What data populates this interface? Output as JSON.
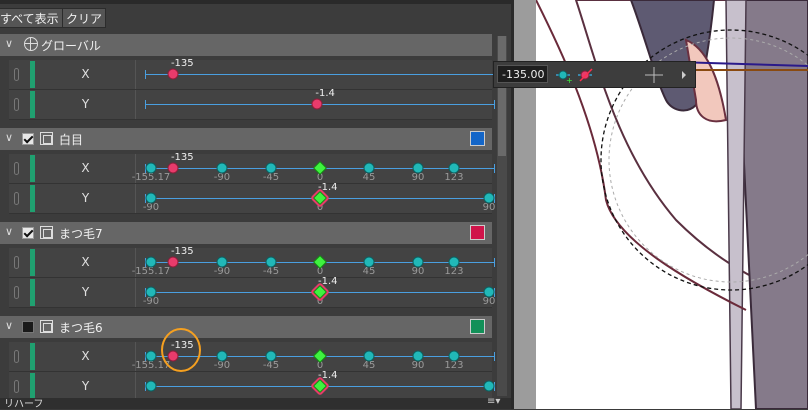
{
  "toolbar": {
    "show_all_label": "すべて表示",
    "clear_label": "クリア"
  },
  "groups": [
    {
      "name": "グローバル",
      "type": "global",
      "checked": null,
      "color": null,
      "rows": [
        {
          "axis": "X",
          "value_label": "-135",
          "labels": [],
          "keys": [
            {
              "v": -135,
              "state": "red",
              "label_pos": -135
            }
          ],
          "range": [
            -155.17,
            155.17
          ]
        },
        {
          "axis": "Y",
          "value_label": "-1.4",
          "labels": [],
          "keys": [
            {
              "v": -1.4,
              "state": "red"
            }
          ],
          "range": [
            -90,
            90
          ]
        }
      ]
    },
    {
      "name": "白目",
      "type": "layer",
      "checked": true,
      "color": "#1466c8",
      "rows": [
        {
          "axis": "X",
          "value_label": "-135",
          "labels": [
            "-155.17",
            "-90",
            "-45",
            "0",
            "45",
            "90",
            "123"
          ],
          "keys": [
            {
              "v": -155.17,
              "state": "teal"
            },
            {
              "v": -135,
              "state": "red"
            },
            {
              "v": -90,
              "state": "teal"
            },
            {
              "v": -45,
              "state": "teal"
            },
            {
              "v": 0,
              "state": "green"
            },
            {
              "v": 45,
              "state": "teal"
            },
            {
              "v": 90,
              "state": "teal"
            },
            {
              "v": 123,
              "state": "teal"
            }
          ],
          "range": [
            -155.17,
            155.17
          ]
        },
        {
          "axis": "Y",
          "value_label": "-1.4",
          "labels": [
            "-90",
            "0",
            "90"
          ],
          "keys": [
            {
              "v": -90,
              "state": "teal"
            },
            {
              "v": 0,
              "state": "green_ring"
            },
            {
              "v": 90,
              "state": "teal"
            }
          ],
          "range": [
            -90,
            90
          ]
        }
      ]
    },
    {
      "name": "まつ毛7",
      "type": "layer",
      "checked": true,
      "color": "#d0144a",
      "rows": [
        {
          "axis": "X",
          "value_label": "-135",
          "labels": [
            "-155.17",
            "-90",
            "-45",
            "0",
            "45",
            "90",
            "123"
          ],
          "keys": [
            {
              "v": -155.17,
              "state": "teal"
            },
            {
              "v": -135,
              "state": "red"
            },
            {
              "v": -90,
              "state": "teal"
            },
            {
              "v": -45,
              "state": "teal"
            },
            {
              "v": 0,
              "state": "green"
            },
            {
              "v": 45,
              "state": "teal"
            },
            {
              "v": 90,
              "state": "teal"
            },
            {
              "v": 123,
              "state": "teal"
            }
          ],
          "range": [
            -155.17,
            155.17
          ]
        },
        {
          "axis": "Y",
          "value_label": "-1.4",
          "labels": [
            "-90",
            "0",
            "90"
          ],
          "keys": [
            {
              "v": -90,
              "state": "teal"
            },
            {
              "v": 0,
              "state": "green_ring"
            },
            {
              "v": 90,
              "state": "teal"
            }
          ],
          "range": [
            -90,
            90
          ]
        }
      ]
    },
    {
      "name": "まつ毛6",
      "type": "layer",
      "checked": false,
      "color": "#129058",
      "rows": [
        {
          "axis": "X",
          "value_label": "-135",
          "labels": [
            "-155.17",
            "-90",
            "-45",
            "0",
            "45",
            "90",
            "123"
          ],
          "keys": [
            {
              "v": -155.17,
              "state": "teal"
            },
            {
              "v": -135,
              "state": "red"
            },
            {
              "v": -90,
              "state": "teal"
            },
            {
              "v": -45,
              "state": "teal"
            },
            {
              "v": 0,
              "state": "green"
            },
            {
              "v": 45,
              "state": "teal"
            },
            {
              "v": 90,
              "state": "teal"
            },
            {
              "v": 123,
              "state": "teal"
            }
          ],
          "range": [
            -155.17,
            155.17
          ]
        },
        {
          "axis": "Y",
          "value_label": "-1.4",
          "labels": [],
          "keys": [
            {
              "v": -90,
              "state": "teal"
            },
            {
              "v": 0,
              "state": "green_ring"
            },
            {
              "v": 90,
              "state": "teal"
            }
          ],
          "range": [
            -90,
            90
          ]
        }
      ]
    }
  ],
  "tooltip": {
    "value": "-135.00"
  },
  "bottom": {
    "label": "リハーフ"
  },
  "icons": {
    "globe": "globe-icon",
    "layer": "layer-frame-icon",
    "chevron": "chevron-down-icon"
  },
  "colors": {
    "track": "#4a9fe0",
    "key_normal": "#21b8b8",
    "key_selected": "#e83b6b",
    "key_center": "#3ff23f"
  }
}
